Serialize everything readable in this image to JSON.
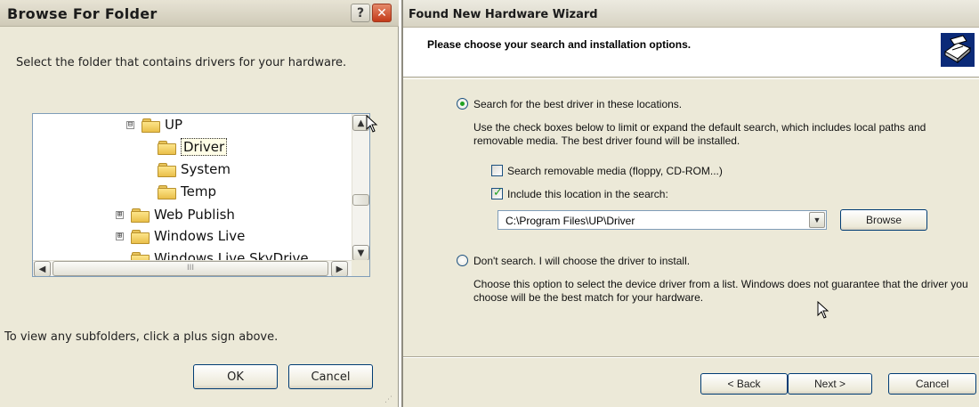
{
  "browse_dialog": {
    "title": "Browse For Folder",
    "help_button": "?",
    "close_button": "✕",
    "prompt": "Select the folder that contains drivers for your hardware.",
    "tree": [
      {
        "label": "UP",
        "expander": "⊟"
      },
      {
        "label": "Driver",
        "selected": true
      },
      {
        "label": "System"
      },
      {
        "label": "Temp"
      },
      {
        "label": "Web Publish",
        "expander": "⊞"
      },
      {
        "label": "Windows Live",
        "expander": "⊞"
      },
      {
        "label": "Windows Live SkyDrive"
      }
    ],
    "scroll_up": "▲",
    "scroll_down": "▼",
    "scroll_left": "◀",
    "scroll_right": "▶",
    "h_thumb_grip": "III",
    "hint": "To view any subfolders, click a plus sign above.",
    "ok_label": "OK",
    "cancel_label": "Cancel"
  },
  "wizard": {
    "title": "Found New Hardware Wizard",
    "heading": "Please choose your search and installation options.",
    "option_search_label": "Search for the best driver in these locations.",
    "option_search_desc": "Use the check boxes below to limit or expand the default search, which includes local paths and removable media. The best driver found will be installed.",
    "removable_media_label": "Search removable media (floppy, CD-ROM...)",
    "removable_media_checked": false,
    "include_location_label": "Include this location in the search:",
    "include_location_checked": true,
    "location_value": "C:\\Program Files\\UP\\Driver",
    "combo_arrow": "▼",
    "browse_label": "Browse",
    "option_manual_label": "Don't search. I will choose the driver to install.",
    "option_manual_desc": "Choose this option to select the device driver from a list.  Windows does not guarantee that the driver you choose will be the best match for your hardware.",
    "back_label": "< Back",
    "next_label": "Next >",
    "cancel_label": "Cancel"
  },
  "icons": {
    "folder": "folder-icon",
    "hardware": "hardware-wizard-icon",
    "cursor": "mouse-pointer-icon"
  }
}
